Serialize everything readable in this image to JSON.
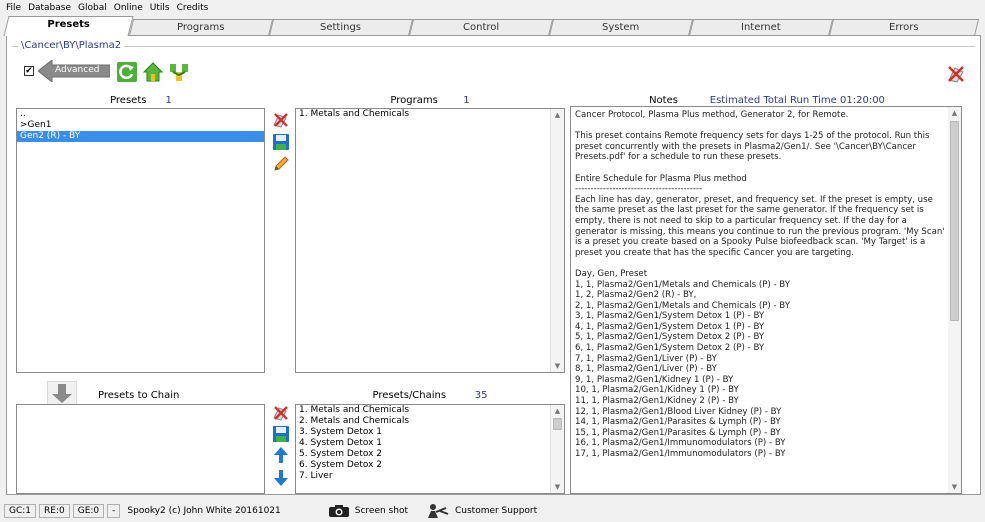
{
  "menu": [
    "File",
    "Database",
    "Global",
    "Online",
    "Utils",
    "Credits"
  ],
  "tabs": [
    {
      "label": "Presets",
      "active": true
    },
    {
      "label": "Programs",
      "active": false
    },
    {
      "label": "Settings",
      "active": false
    },
    {
      "label": "Control",
      "active": false
    },
    {
      "label": "System",
      "active": false
    },
    {
      "label": "Internet",
      "active": false
    },
    {
      "label": "Errors",
      "active": false
    }
  ],
  "path": "\\Cancer\\BY\\Plasma2",
  "advanced": {
    "label": "Advanced",
    "checked": true,
    "check_mark": "✔"
  },
  "presets": {
    "header": "Presets",
    "count": "1",
    "items": [
      {
        "label": "..",
        "selected": false
      },
      {
        "label": ">Gen1",
        "selected": false
      },
      {
        "label": "Gen2 (R) - BY",
        "selected": true
      }
    ]
  },
  "programs": {
    "header": "Programs",
    "count": "1",
    "items": [
      "1. Metals and Chemicals"
    ]
  },
  "notes": {
    "header": "Notes",
    "run_time": "Estimated Total Run Time 01:20:00",
    "lines": [
      "Cancer Protocol, Plasma Plus method, Generator 2, for Remote.",
      "",
      "This preset contains Remote frequency sets for days 1-25 of the protocol. Run this preset concurrently with the presets in Plasma2/Gen1/. See '\\Cancer\\BY\\Cancer Presets.pdf' for a schedule to run these presets.",
      "",
      "Entire Schedule for Plasma Plus method",
      "-----------------------------------------",
      "Each line has day, generator, preset, and frequency set. If the preset is empty, use the same preset as the last preset for the same generator. If the frequency set is empty, there is not need to skip to a particular frequency set. If the day for a generator is missing, this means you continue to run the previous program. 'My Scan' is a preset you create based on a Spooky Pulse biofeedback scan. 'My Target' is a preset you create that has the specific Cancer you are targeting.",
      "",
      "Day, Gen, Preset",
      "1, 1, Plasma2/Gen1/Metals and Chemicals (P) - BY",
      "1, 2, Plasma2/Gen2 (R) - BY,",
      "2, 1, Plasma2/Gen1/Metals and Chemicals (P) - BY",
      "3, 1, Plasma2/Gen1/System Detox 1 (P) - BY",
      "4, 1, Plasma2/Gen1/System Detox 1 (P) - BY",
      "5, 1, Plasma2/Gen1/System Detox 2 (P) - BY",
      "6, 1, Plasma2/Gen1/System Detox 2 (P) - BY",
      "7, 1, Plasma2/Gen1/Liver (P) - BY",
      "8, 1, Plasma2/Gen1/Liver (P) - BY",
      "9, 1, Plasma2/Gen1/Kidney 1 (P) - BY",
      "10, 1, Plasma2/Gen1/Kidney 1 (P) - BY",
      "11, 1, Plasma2/Gen1/Kidney 2 (P) - BY",
      "12, 1, Plasma2/Gen1/Blood Liver Kidney (P) - BY",
      "14, 1, Plasma2/Gen1/Parasites & Lymph (P) - BY",
      "15, 1, Plasma2/Gen1/Parasites & Lymph (P) - BY",
      "16, 1, Plasma2/Gen1/Immunomodulators (P) - BY",
      "17, 1, Plasma2/Gen1/Immunomodulators (P) - BY"
    ]
  },
  "chain": {
    "header": "Presets to Chain",
    "items": []
  },
  "preset_chains": {
    "header": "Presets/Chains",
    "count": "35",
    "items": [
      "1. Metals and Chemicals",
      "2. Metals and Chemicals",
      "3. System Detox 1",
      "4. System Detox 1",
      "5. System Detox 2",
      "6. System Detox 2",
      "7. Liver"
    ]
  },
  "status": {
    "gc": "GC:1",
    "re": "RE:0",
    "ge": "GE:0",
    "dash": "-",
    "credit": "Spooky2 (c) John White 20161021",
    "screenshot": "Screen shot",
    "support": "Customer Support"
  },
  "colors": {
    "selection": "#3b8ee8",
    "count_text": "#2f3a8f",
    "arrow_gray": "#8a8a8a"
  }
}
